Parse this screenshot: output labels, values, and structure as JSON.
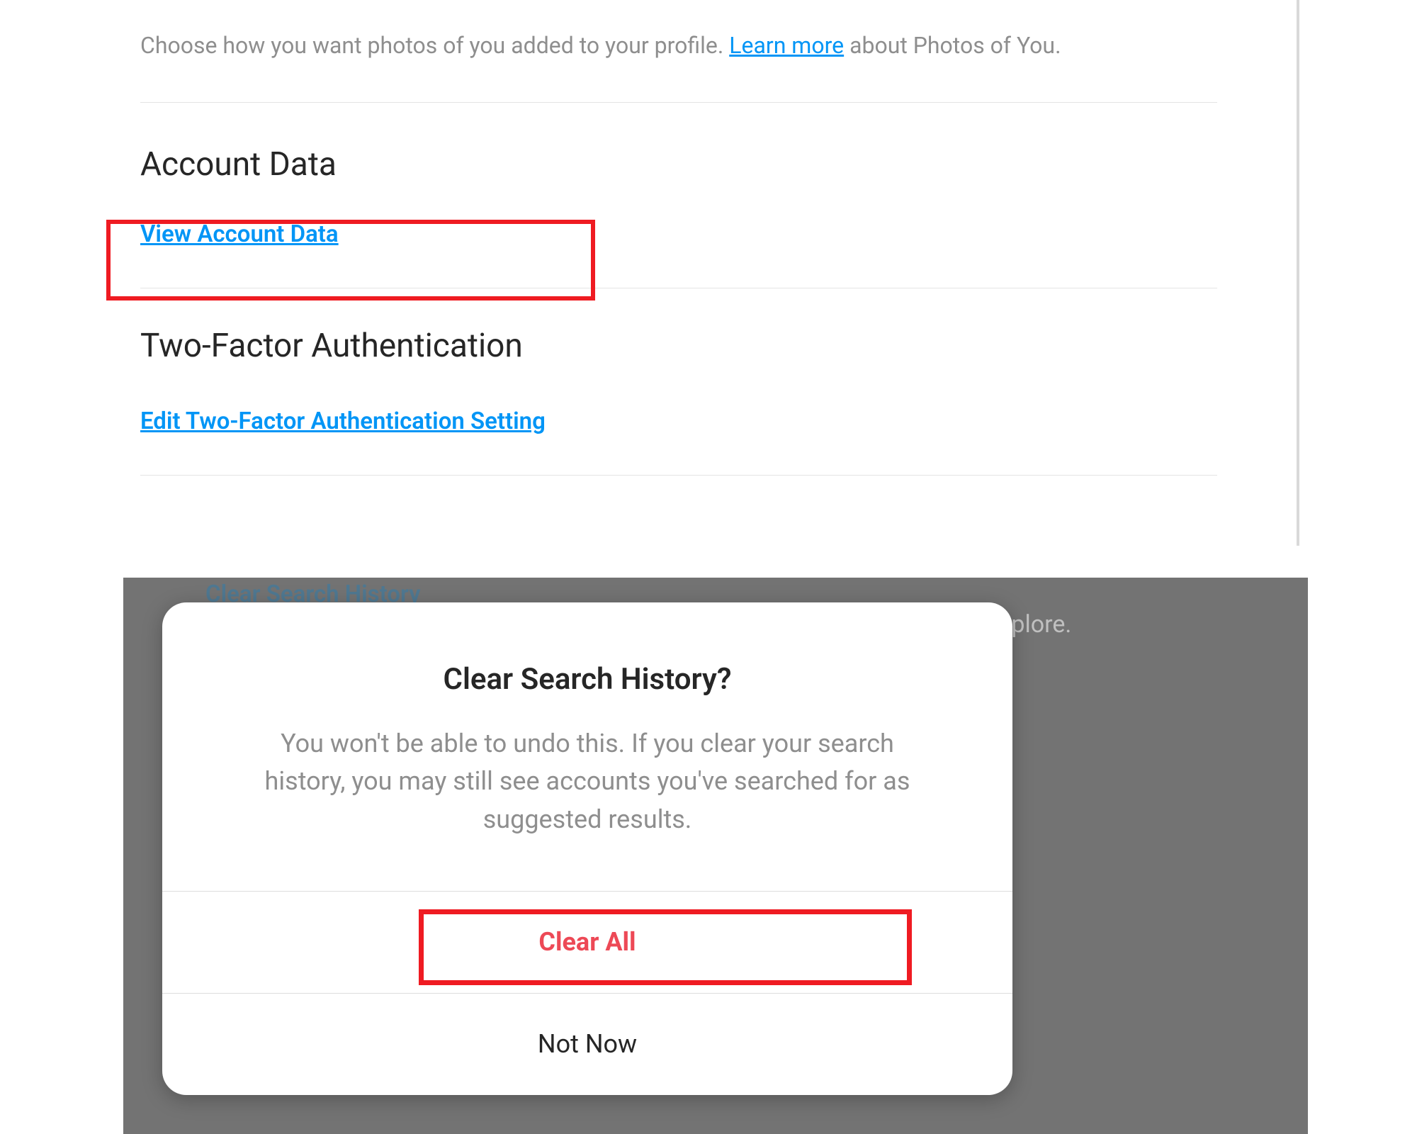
{
  "photos_of_you": {
    "desc_before": "Choose how you want photos of you added to your profile. ",
    "link_text": "Learn more",
    "desc_after": " about Photos of You."
  },
  "sections": {
    "account_data": {
      "title": "Account Data",
      "link": "View Account Data"
    },
    "two_factor": {
      "title": "Two-Factor Authentication",
      "link": "Edit Two-Factor Authentication Setting"
    }
  },
  "background": {
    "clear_link": "Clear Search History",
    "explore_fragment": "n Explore."
  },
  "modal": {
    "title": "Clear Search History?",
    "body": "You won't be able to undo this. If you clear your search history, you may still see accounts you've searched for as suggested results.",
    "clear_all": "Clear All",
    "not_now": "Not Now"
  }
}
